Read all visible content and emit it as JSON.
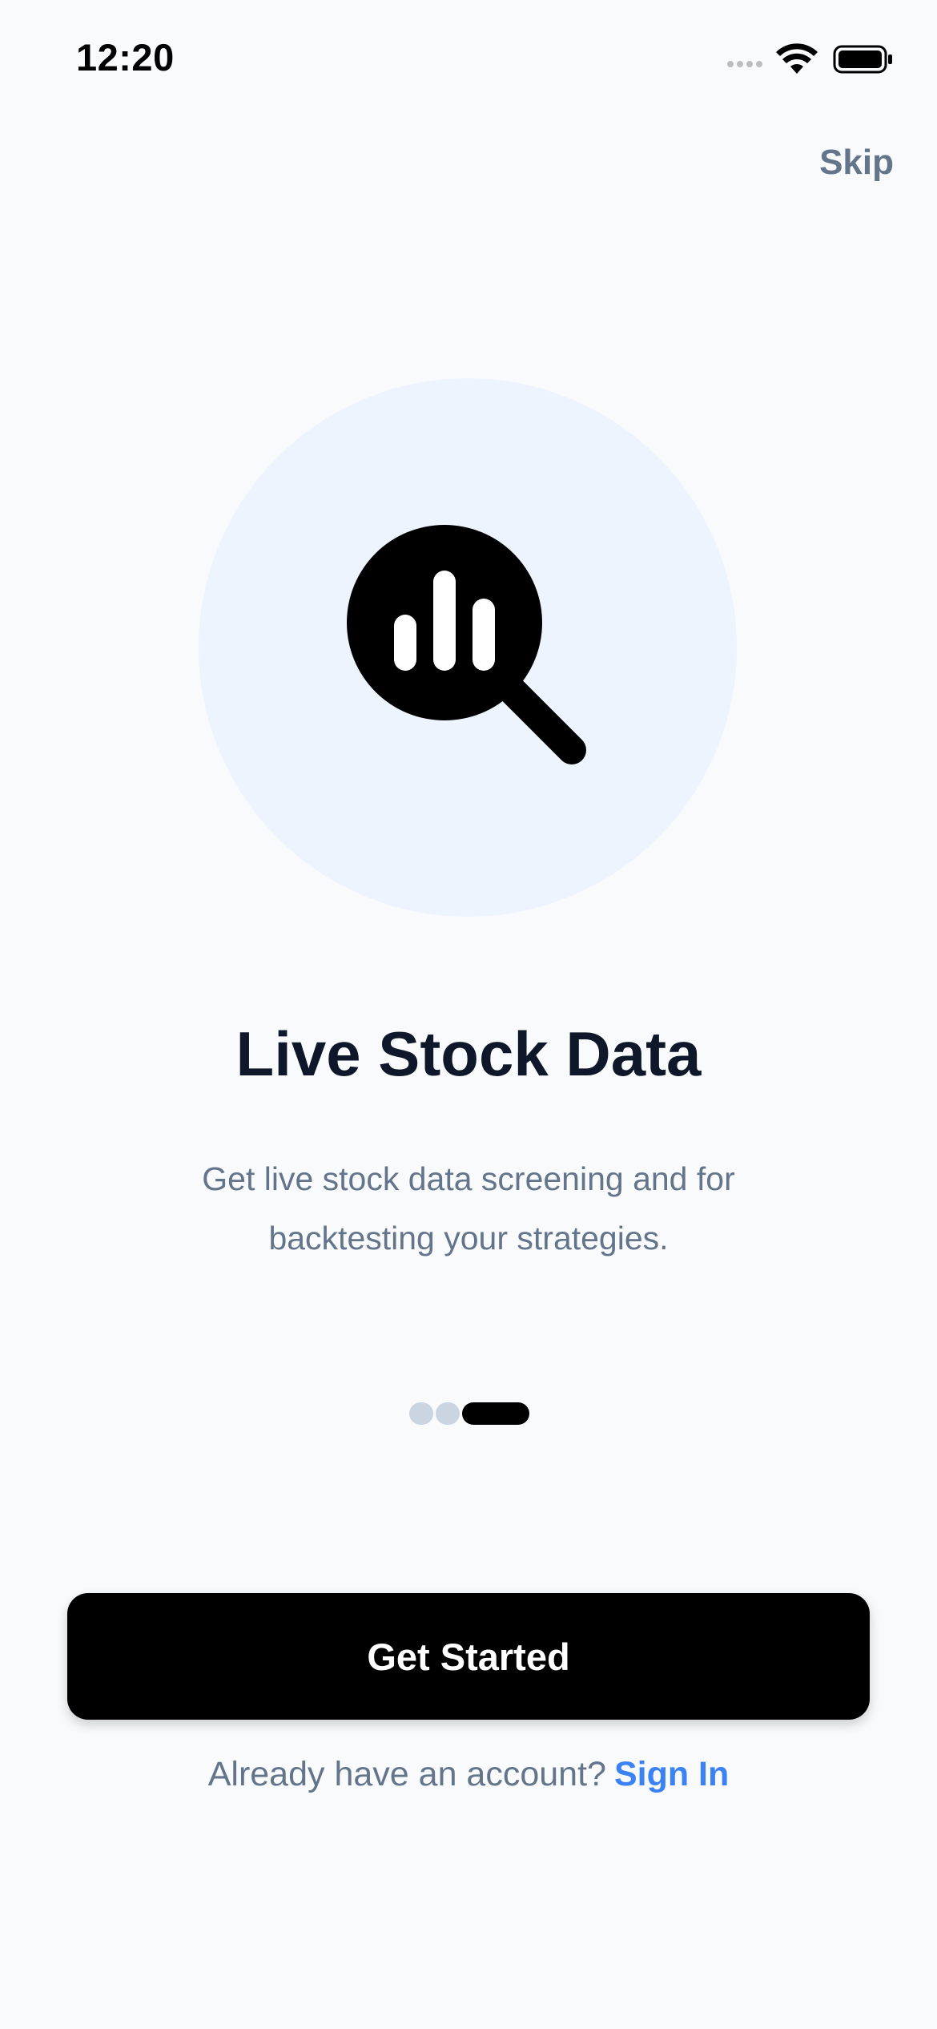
{
  "status_bar": {
    "time": "12:20"
  },
  "header": {
    "skip_label": "Skip"
  },
  "hero": {
    "icon": "chart-search-icon",
    "circle_color": "#eef4fe"
  },
  "content": {
    "title": "Live Stock Data",
    "description": "Get live stock data screening and for backtesting your strategies."
  },
  "pagination": {
    "total": 3,
    "active_index": 3
  },
  "actions": {
    "primary_label": "Get Started",
    "signin_prompt": "Already have an account?",
    "signin_link": "Sign In"
  },
  "colors": {
    "background": "#f8fafc",
    "primary": "#000000",
    "link": "#3b82f6",
    "muted_text": "#64748b",
    "title_text": "#0f172a"
  }
}
